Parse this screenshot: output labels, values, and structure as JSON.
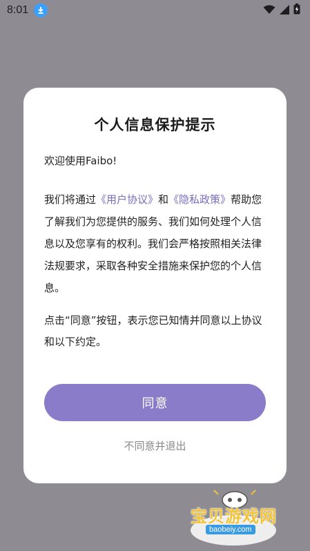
{
  "status_bar": {
    "time": "8:01"
  },
  "dialog": {
    "title": "个人信息保护提示",
    "welcome": "欢迎使用Faibo!",
    "intro_prefix": "我们将通过",
    "user_agreement_link": "《用户协议》",
    "and_text": "和",
    "privacy_policy_link": "《隐私政策》",
    "intro_suffix": "帮助您了解我们为您提供的服务、我们如何处理个人信息以及您享有的权利。我们会严格按照相关法律法规要求，采取各种安全措施来保护您的个人信息。",
    "notice": "点击“同意”按钮，表示您已知情并同意以上协议和以下约定。",
    "agree_label": "同意",
    "disagree_label": "不同意并退出",
    "accent_color": "#8a7cc9",
    "link_color": "#7a6cc0"
  },
  "watermark": {
    "title": "宝贝游戏网",
    "url": "baobeiy.com"
  }
}
